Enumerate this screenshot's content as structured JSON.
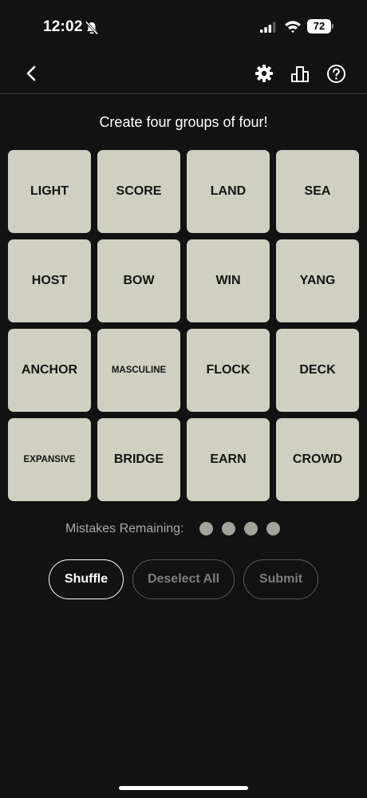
{
  "status_bar": {
    "time": "12:02",
    "battery": "72"
  },
  "instructions": "Create four groups of four!",
  "tiles": [
    {
      "label": "LIGHT"
    },
    {
      "label": "SCORE"
    },
    {
      "label": "LAND"
    },
    {
      "label": "SEA"
    },
    {
      "label": "HOST"
    },
    {
      "label": "BOW"
    },
    {
      "label": "WIN"
    },
    {
      "label": "YANG"
    },
    {
      "label": "ANCHOR"
    },
    {
      "label": "MASCULINE"
    },
    {
      "label": "FLOCK"
    },
    {
      "label": "DECK"
    },
    {
      "label": "EXPANSIVE"
    },
    {
      "label": "BRIDGE"
    },
    {
      "label": "EARN"
    },
    {
      "label": "CROWD"
    }
  ],
  "mistakes": {
    "label": "Mistakes Remaining:",
    "remaining": 4
  },
  "buttons": {
    "shuffle": "Shuffle",
    "deselect": "Deselect All",
    "submit": "Submit"
  },
  "colors": {
    "background": "#121212",
    "tile": "#d0d0c2",
    "dot": "#a3a39a",
    "disabled": "#7d7d7d"
  },
  "icons": [
    "bell-slash-icon",
    "signal-icon",
    "wifi-icon",
    "battery-icon",
    "back-chevron-icon",
    "gear-icon",
    "leaderboard-icon",
    "help-icon"
  ]
}
